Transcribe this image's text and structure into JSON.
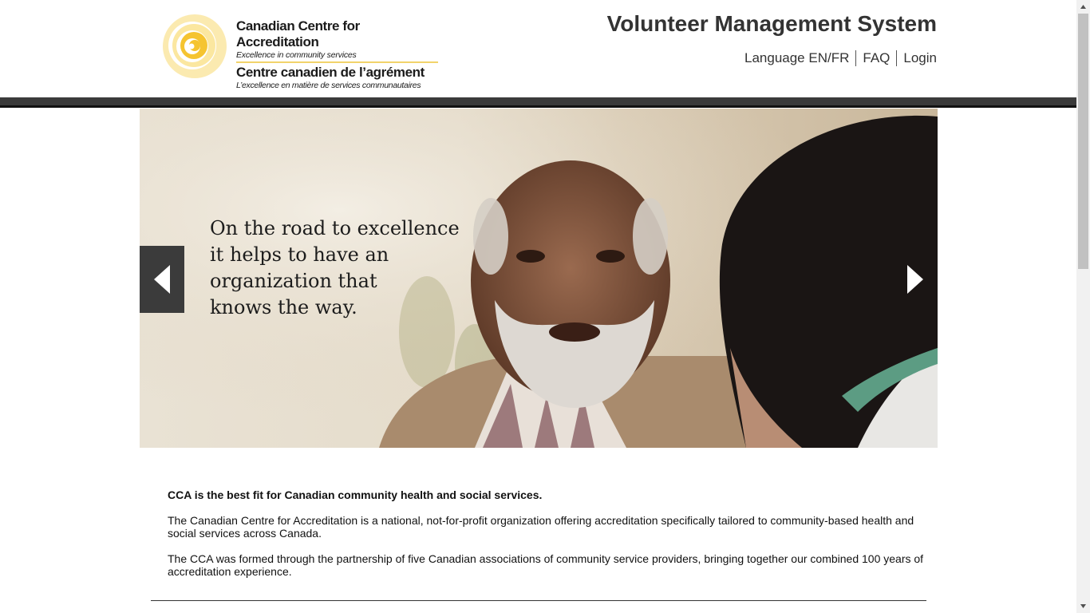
{
  "header": {
    "logo": {
      "en_title": "Canadian Centre for Accreditation",
      "en_tagline": "Excellence in community services",
      "fr_title": "Centre canadien de l’agrément",
      "fr_tagline": "L’excellence en matière de services communautaires"
    },
    "site_title": "Volunteer Management System",
    "nav": {
      "language": "Language EN/FR",
      "faq": "FAQ",
      "login": "Login"
    }
  },
  "hero": {
    "caption_lines": [
      "On the road to excellence",
      "it helps to have an",
      "organization that",
      "knows the way."
    ],
    "prev_icon": "chevron-left-icon",
    "next_icon": "chevron-right-icon"
  },
  "content": {
    "lead": "CCA is the best fit for Canadian community health and social services.",
    "paragraphs": [
      "The Canadian Centre for Accreditation is a national, not-for-profit organization offering accreditation specifically tailored to community-based health and social services across Canada.",
      "The CCA was formed through the partnership of five Canadian associations of community service providers, bringing together our combined 100 years of accreditation experience."
    ]
  },
  "colors": {
    "brand_yellow": "#f5c430",
    "dark_bar": "#3a3a3a",
    "text": "#333333"
  }
}
